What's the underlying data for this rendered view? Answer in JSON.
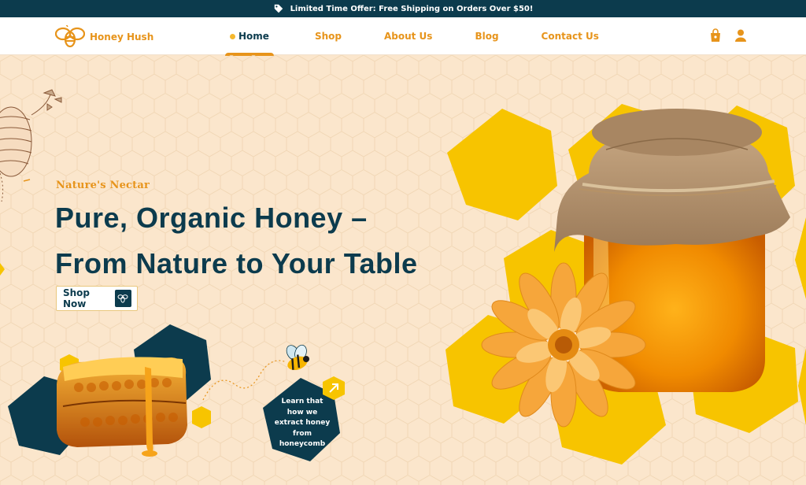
{
  "announcement": {
    "text": "Limited Time Offer: Free Shipping on Orders Over $50!"
  },
  "brand": {
    "name": "Honey Hush"
  },
  "nav": {
    "items": [
      {
        "label": "Home",
        "active": true
      },
      {
        "label": "Shop",
        "active": false
      },
      {
        "label": "About Us",
        "active": false
      },
      {
        "label": "Blog",
        "active": false
      },
      {
        "label": "Contact Us",
        "active": false
      }
    ]
  },
  "hero": {
    "eyebrow": "Nature's Nectar",
    "title_line1": "Pure, Organic Honey –",
    "title_line2": "From Nature to Your Table",
    "cta_label": "Shop Now",
    "learn_line1": "Learn that",
    "learn_line2": "how we",
    "learn_line3": "extract honey",
    "learn_line4": "from",
    "learn_line5": "honeycomb"
  },
  "colors": {
    "navy": "#0c3b4d",
    "accent": "#e7941b",
    "yellow": "#f7c400",
    "background": "#fbe6cc"
  },
  "icons": [
    "tag-icon",
    "bee-logo-icon",
    "shopping-bag-icon",
    "user-icon",
    "bee-icon",
    "arrow-up-right-icon"
  ]
}
